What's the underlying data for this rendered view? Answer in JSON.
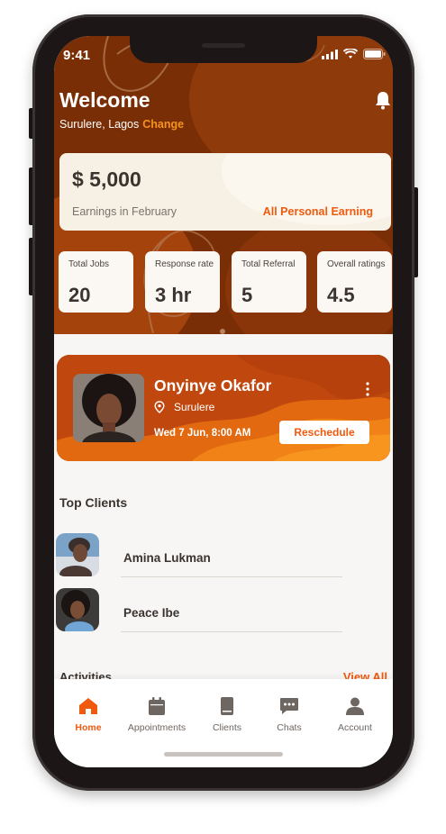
{
  "status_bar": {
    "time": "9:41"
  },
  "header": {
    "welcome": "Welcome",
    "location": "Surulere, Lagos",
    "change_link": "Change"
  },
  "earnings": {
    "amount": "$ 5,000",
    "label": "Earnings in February",
    "link": "All Personal Earning"
  },
  "stats": [
    {
      "label": "Total Jobs",
      "value": "20"
    },
    {
      "label": "Response rate",
      "value": "3 hr"
    },
    {
      "label": "Total Referral",
      "value": "5"
    },
    {
      "label": "Overall ratings",
      "value": "4.5"
    }
  ],
  "appointment": {
    "name": "Onyinye Okafor",
    "location": "Surulere",
    "datetime": "Wed 7 Jun, 8:00 AM",
    "button": "Reschedule"
  },
  "top_clients": {
    "title": "Top Clients",
    "clients": [
      {
        "name": "Amina Lukman"
      },
      {
        "name": "Peace Ibe"
      }
    ]
  },
  "activities": {
    "title": "Activities",
    "view_all": "View All"
  },
  "tabs": [
    {
      "label": "Home",
      "icon": "home-icon",
      "active": true
    },
    {
      "label": "Appointments",
      "icon": "calendar-icon",
      "active": false
    },
    {
      "label": "Clients",
      "icon": "book-icon",
      "active": false
    },
    {
      "label": "Chats",
      "icon": "chat-icon",
      "active": false
    },
    {
      "label": "Account",
      "icon": "person-icon",
      "active": false
    }
  ],
  "colors": {
    "accent": "#f05a0e",
    "hero_bg": "#7a2e05",
    "change_link": "#f7931e",
    "text_dark": "#3b332e"
  }
}
